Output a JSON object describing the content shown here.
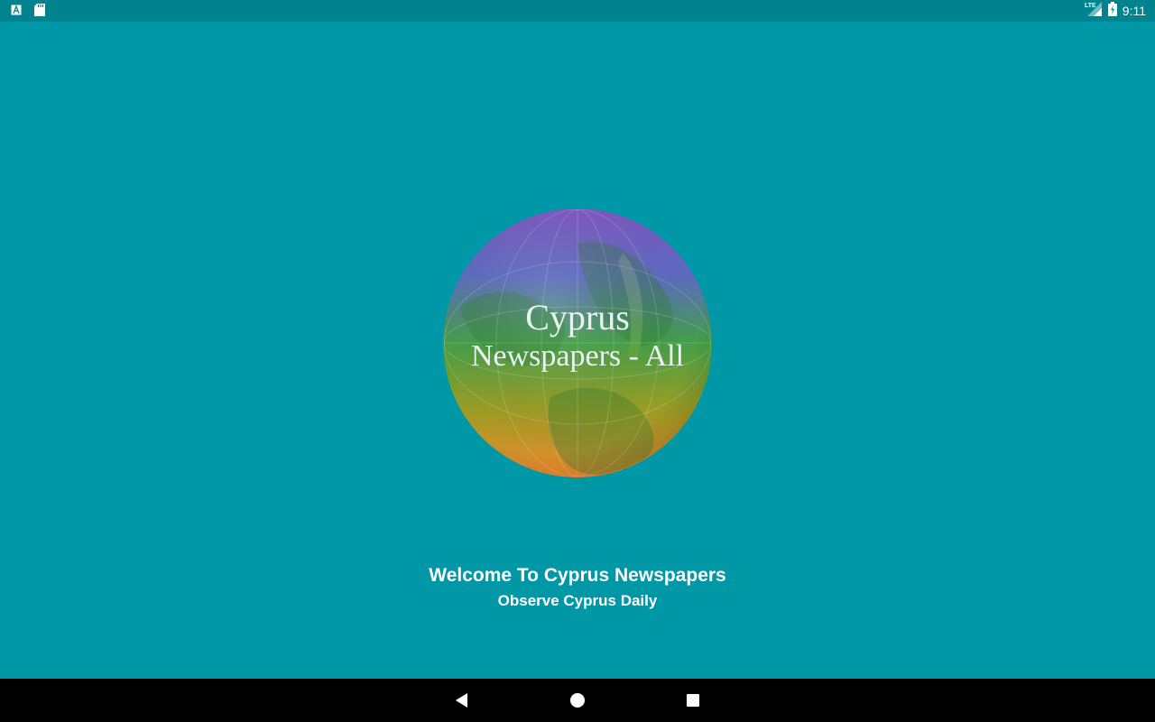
{
  "status_bar": {
    "time": "9:11",
    "network": "LTE",
    "icons": [
      "text-a-icon",
      "sd-card-icon",
      "lte-signal-icon",
      "battery-charging-icon"
    ]
  },
  "splash": {
    "logo_line1": "Cyprus",
    "logo_line2": "Newspapers - All",
    "welcome_title": "Welcome To Cyprus Newspapers",
    "welcome_subtitle": "Observe Cyprus Daily"
  },
  "nav_bar": {
    "icons": [
      "back-icon",
      "home-icon",
      "recents-icon"
    ]
  },
  "colors": {
    "background": "#0097a7",
    "status_bar": "#00838f",
    "nav_bar": "#000000",
    "text": "#ffffff"
  }
}
